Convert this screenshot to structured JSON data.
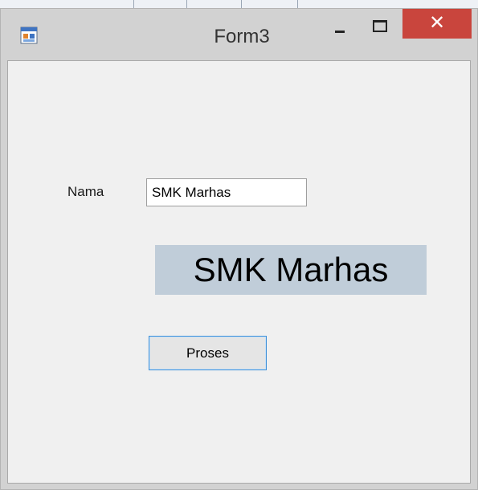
{
  "window": {
    "title": "Form3",
    "close_glyph": "✕",
    "icons": {
      "app": "app-form-icon",
      "minimize": "minimize-icon",
      "maximize": "maximize-icon",
      "close": "close-icon"
    },
    "colors": {
      "close_button": "#c9453d",
      "frame": "#d2d2d2",
      "client_background": "#f0f0f0",
      "output_label_background": "#c0cdd9",
      "button_border": "#3c8fd8"
    }
  },
  "form": {
    "name_label": "Nama",
    "name_value": "SMK Marhas",
    "output_text": "SMK Marhas",
    "process_button": "Proses"
  }
}
